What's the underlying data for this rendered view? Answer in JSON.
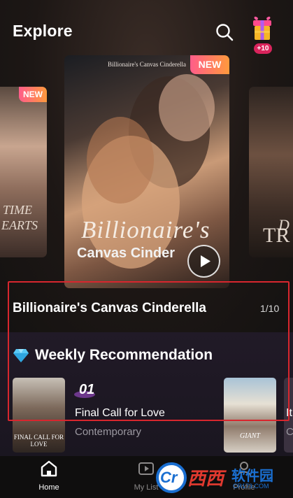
{
  "header": {
    "title": "Explore",
    "search_icon": "search-icon",
    "gift_icon": "gift-icon",
    "gift_badge": "+10"
  },
  "carousel": {
    "left_card": {
      "badge": "NEW",
      "text_line1": "TIME",
      "text_line2": "EARTS"
    },
    "main_card": {
      "badge": "NEW",
      "cover_top_text": "Billionaire's Canvas Cinderella",
      "cover_script": "Billionaire's",
      "cover_sub": "Canvas Cinder"
    },
    "right_card": {
      "text_line1": "D",
      "text_line2": "TR"
    }
  },
  "featured": {
    "title": "Billionaire's Canvas Cinderella",
    "pager": "1/10"
  },
  "weekly": {
    "icon": "diamond-icon",
    "title": "Weekly Recommendation",
    "items": [
      {
        "rank": "01",
        "title": "Final Call for Love",
        "genre": "Contemporary",
        "cover_text": "FINAL CALL FOR LOVE"
      },
      {
        "cover_text": "GIANT"
      },
      {
        "title_peek": "It",
        "genre_peek": "Co"
      }
    ]
  },
  "bottom_nav": {
    "items": [
      {
        "label": "Home",
        "icon": "home-icon",
        "active": true
      },
      {
        "label": "My List",
        "icon": "play-list-icon",
        "active": false
      },
      {
        "label": "Profile",
        "icon": "profile-icon",
        "active": false
      }
    ]
  },
  "watermark": {
    "logo": "Cr",
    "brand": "西西",
    "site_name": "软件园",
    "url": "CR173.COM"
  },
  "colors": {
    "accent_red": "#d8262e",
    "badge_pink": "#ff5d8a",
    "badge_orange": "#ff9a3c",
    "watermark_blue": "#1a6fd1"
  }
}
